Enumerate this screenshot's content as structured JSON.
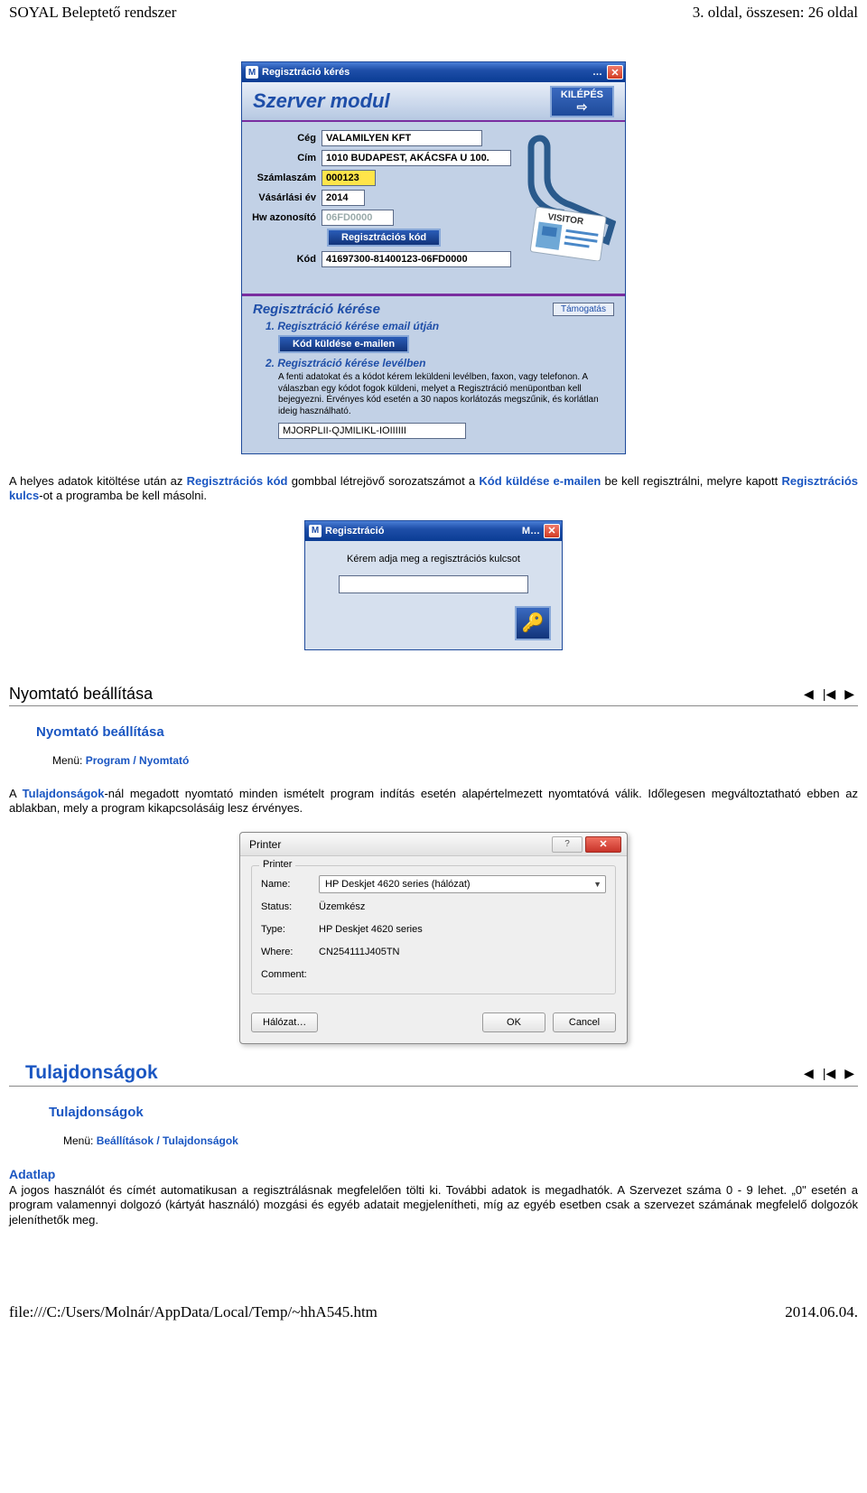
{
  "page": {
    "header_left": "SOYAL Beleptető rendszer",
    "header_right": "3. oldal, összesen: 26 oldal",
    "footer_left": "file:///C:/Users/Molnár/AppData/Local/Temp/~hhA545.htm",
    "footer_right": "2014.06.04."
  },
  "reg_modal": {
    "title": "Regisztráció kérés",
    "header": "Szerver modul",
    "exit_btn": "KILÉPÉS",
    "fields": {
      "ceg_label": "Cég",
      "ceg_value": "VALAMILYEN KFT",
      "cim_label": "Cím",
      "cim_value": "1010 BUDAPEST, AKÁCSFA U 100.",
      "szamla_label": "Számlaszám",
      "szamla_value": "000123",
      "ev_label": "Vásárlási év",
      "ev_value": "2014",
      "hw_label": "Hw azonosító",
      "hw_value": "06FD0000",
      "regkod_btn": "Regisztrációs kód",
      "kod_label": "Kód",
      "kod_value": "41697300-81400123-06FD0000"
    },
    "request": {
      "title": "Regisztráció kérése",
      "support_btn": "Támogatás",
      "step1": "1.  Regisztráció kérése email útján",
      "send_btn": "Kód küldése e-mailen",
      "step2": "2.  Regisztráció kérése levélben",
      "desc": "A fenti adatokat és a kódot kérem leküldeni levélben, faxon, vagy telefonon. A válaszban egy kódot fogok küldeni, melyet a Regisztráció menüpontban kell bejegyezni. Érvényes kód esetén a 30 napos korlátozás megszűnik, és korlátlan ideig használható.",
      "code_value": "MJORPLII-QJMILIKL-IOIIIIII"
    }
  },
  "para1": {
    "seg1": "A helyes adatok kitöltése után az ",
    "hl1": "Regisztrációs kód",
    "seg2": " gombbal létrejövő sorozatszámot a ",
    "hl2": "Kód küldése e-mailen",
    "seg3": " be kell regisztrálni, melyre kapott ",
    "hl3": "Regisztrációs kulcs",
    "seg4": "-ot a programba be kell másolni."
  },
  "key_modal": {
    "title": "Regisztráció",
    "title_right": "M…",
    "prompt": "Kérem adja meg a regisztrációs kulcsot"
  },
  "section_printer": {
    "heading": "Nyomtató beállítása",
    "sub": "Nyomtató beállítása",
    "menu_label": "Menü: ",
    "menu_value": "Program / Nyomtató"
  },
  "para2": {
    "seg1": "A ",
    "hl1": "Tulajdonságok",
    "seg2": "-nál megadott nyomtató minden ismételt program indítás esetén alapértelmezett nyomtatóvá válik. Időlegesen megváltoztatható ebben az ablakban, mely a program kikapcsolásáig lesz érvényes."
  },
  "printer_dlg": {
    "title": "Printer",
    "group": "Printer",
    "name_label": "Name:",
    "name_value": "HP Deskjet 4620 series (hálózat)",
    "status_label": "Status:",
    "status_value": "Üzemkész",
    "type_label": "Type:",
    "type_value": "HP Deskjet 4620 series",
    "where_label": "Where:",
    "where_value": "CN254111J405TN",
    "comment_label": "Comment:",
    "halozat_btn": "Hálózat…",
    "ok_btn": "OK",
    "cancel_btn": "Cancel"
  },
  "section_props": {
    "heading": "Tulajdonságok",
    "sub": "Tulajdonságok",
    "menu_label": "Menü: ",
    "menu_value": "Beállítások / Tulajdonságok"
  },
  "adatlap": {
    "heading": "Adatlap",
    "text": "A jogos használót és címét automatikusan a regisztrálásnak megfelelően tölti ki. További adatok is megadhatók. A Szervezet száma 0 - 9 lehet. „0\" esetén a program valamennyi dolgozó (kártyát használó) mozgási és egyéb adatait megjelenítheti, míg az egyéb esetben csak a szervezet számának megfelelő dolgozók jeleníthetők meg."
  }
}
